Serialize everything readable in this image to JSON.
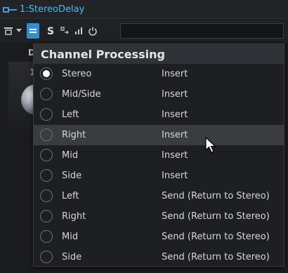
{
  "window": {
    "title": "1:StereoDelay",
    "title_color": "#4fb7f0"
  },
  "toolbar": {
    "buttons": [
      {
        "name": "routing",
        "icon": "routing-icon"
      },
      {
        "name": "routing-dropdown",
        "icon": "chevron-down-icon"
      },
      {
        "name": "channel-processing",
        "icon": "channel-processing-icon",
        "active": true
      },
      {
        "name": "solo",
        "icon": "sidechain-s-icon"
      },
      {
        "name": "preset",
        "icon": "preset-icon"
      },
      {
        "name": "meter",
        "icon": "meter-icon"
      },
      {
        "name": "bypass",
        "icon": "power-icon"
      }
    ],
    "field_value": ""
  },
  "background": {
    "partial_label": "D",
    "knob_label": "1"
  },
  "menu": {
    "title": "Channel Processing",
    "hovered_index": 3,
    "items": [
      {
        "label": "Stereo",
        "mode": "Insert",
        "checked": true
      },
      {
        "label": "Mid/Side",
        "mode": "Insert",
        "checked": false
      },
      {
        "label": "Left",
        "mode": "Insert",
        "checked": false
      },
      {
        "label": "Right",
        "mode": "Insert",
        "checked": false
      },
      {
        "label": "Mid",
        "mode": "Insert",
        "checked": false
      },
      {
        "label": "Side",
        "mode": "Insert",
        "checked": false
      },
      {
        "label": "Left",
        "mode": "Send (Return to Stereo)",
        "checked": false
      },
      {
        "label": "Right",
        "mode": "Send (Return to Stereo)",
        "checked": false
      },
      {
        "label": "Mid",
        "mode": "Send (Return to Stereo)",
        "checked": false
      },
      {
        "label": "Side",
        "mode": "Send (Return to Stereo)",
        "checked": false
      }
    ]
  },
  "colors": {
    "accent": "#2e8fd2",
    "menu_bg": "#1e1f22",
    "menu_header_bg": "#2f3236",
    "hover_bg": "#3a3c40"
  }
}
